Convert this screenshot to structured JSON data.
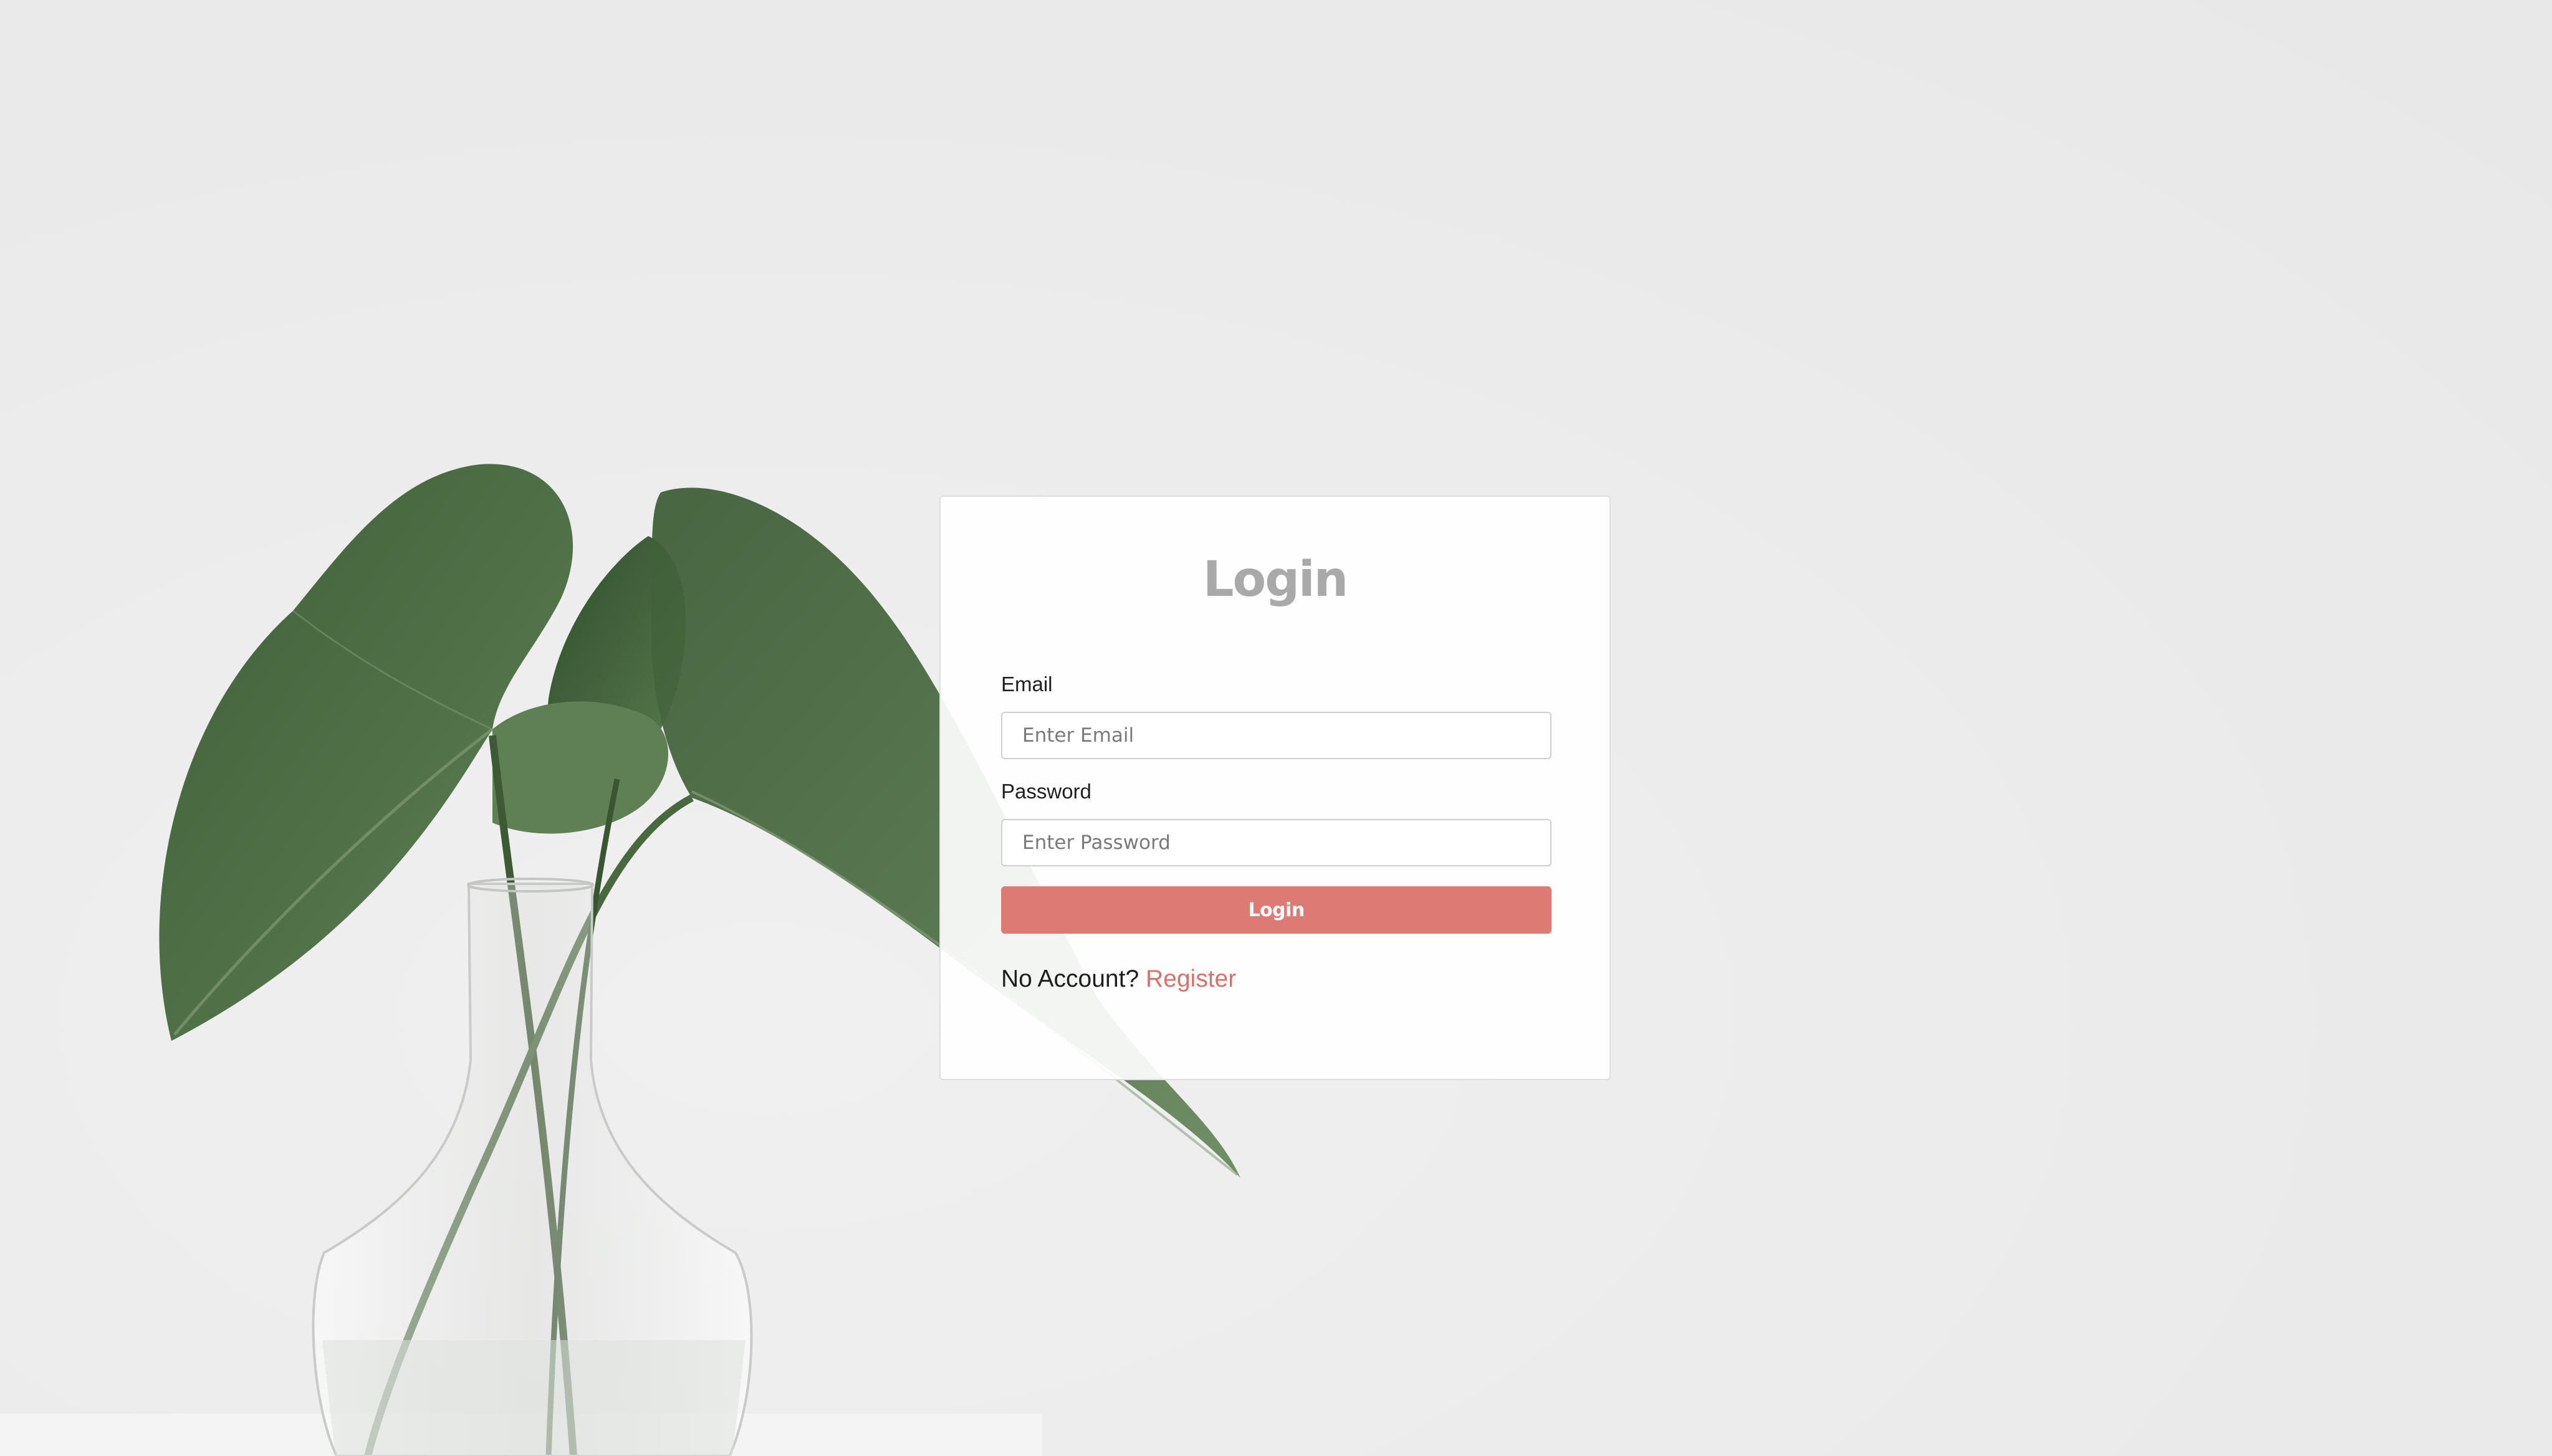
{
  "page": {
    "background_color": "#ececec"
  },
  "login_card": {
    "title": "Login",
    "email": {
      "label": "Email",
      "placeholder": "Enter Email",
      "value": ""
    },
    "password": {
      "label": "Password",
      "placeholder": "Enter Password",
      "value": ""
    },
    "submit_label": "Login",
    "footer": {
      "prompt": "No Account?",
      "link_label": "Register"
    }
  },
  "colors": {
    "accent": "#dd7a74",
    "link": "#d8706b",
    "title": "#a9a9a9",
    "leaf": "#4c6b43",
    "card_background": "#ffffff"
  },
  "icons": {
    "background_illustration": "plant-in-glass-vase-illustration"
  }
}
